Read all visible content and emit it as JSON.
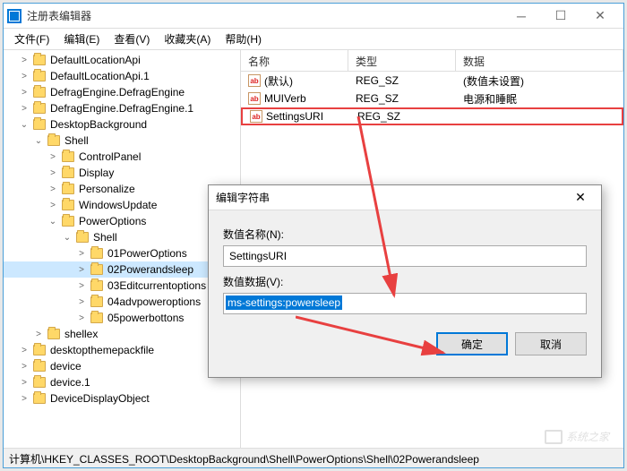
{
  "window": {
    "title": "注册表编辑器",
    "menu": [
      "文件(F)",
      "编辑(E)",
      "查看(V)",
      "收藏夹(A)",
      "帮助(H)"
    ]
  },
  "tree": [
    {
      "label": "DefaultLocationApi",
      "indent": 1,
      "twisty": ">"
    },
    {
      "label": "DefaultLocationApi.1",
      "indent": 1,
      "twisty": ">"
    },
    {
      "label": "DefragEngine.DefragEngine",
      "indent": 1,
      "twisty": ">"
    },
    {
      "label": "DefragEngine.DefragEngine.1",
      "indent": 1,
      "twisty": ">"
    },
    {
      "label": "DesktopBackground",
      "indent": 1,
      "twisty": "v"
    },
    {
      "label": "Shell",
      "indent": 2,
      "twisty": "v"
    },
    {
      "label": "ControlPanel",
      "indent": 3,
      "twisty": ">"
    },
    {
      "label": "Display",
      "indent": 3,
      "twisty": ">"
    },
    {
      "label": "Personalize",
      "indent": 3,
      "twisty": ">"
    },
    {
      "label": "WindowsUpdate",
      "indent": 3,
      "twisty": ">"
    },
    {
      "label": "PowerOptions",
      "indent": 3,
      "twisty": "v"
    },
    {
      "label": "Shell",
      "indent": 4,
      "twisty": "v"
    },
    {
      "label": "01PowerOptions",
      "indent": 5,
      "twisty": ">"
    },
    {
      "label": "02Powerandsleep",
      "indent": 5,
      "twisty": ">",
      "selected": true
    },
    {
      "label": "03Editcurrentoptions",
      "indent": 5,
      "twisty": ">"
    },
    {
      "label": "04advpoweroptions",
      "indent": 5,
      "twisty": ">"
    },
    {
      "label": "05powerbottons",
      "indent": 5,
      "twisty": ">"
    },
    {
      "label": "shellex",
      "indent": 2,
      "twisty": ">"
    },
    {
      "label": "desktopthemepackfile",
      "indent": 1,
      "twisty": ">"
    },
    {
      "label": "device",
      "indent": 1,
      "twisty": ">"
    },
    {
      "label": "device.1",
      "indent": 1,
      "twisty": ">"
    },
    {
      "label": "DeviceDisplayObject",
      "indent": 1,
      "twisty": ">"
    }
  ],
  "list": {
    "headers": [
      "名称",
      "类型",
      "数据"
    ],
    "rows": [
      {
        "name": "(默认)",
        "type": "REG_SZ",
        "data": "(数值未设置)"
      },
      {
        "name": "MUIVerb",
        "type": "REG_SZ",
        "data": "电源和睡眠"
      },
      {
        "name": "SettingsURI",
        "type": "REG_SZ",
        "data": "",
        "selected": true
      }
    ]
  },
  "dialog": {
    "title": "编辑字符串",
    "name_label": "数值名称(N):",
    "name_value": "SettingsURI",
    "data_label": "数值数据(V):",
    "data_value": "ms-settings:powersleep",
    "ok": "确定",
    "cancel": "取消"
  },
  "statusbar": "计算机\\HKEY_CLASSES_ROOT\\DesktopBackground\\Shell\\PowerOptions\\Shell\\02Powerandsleep",
  "watermark": "系统之家"
}
